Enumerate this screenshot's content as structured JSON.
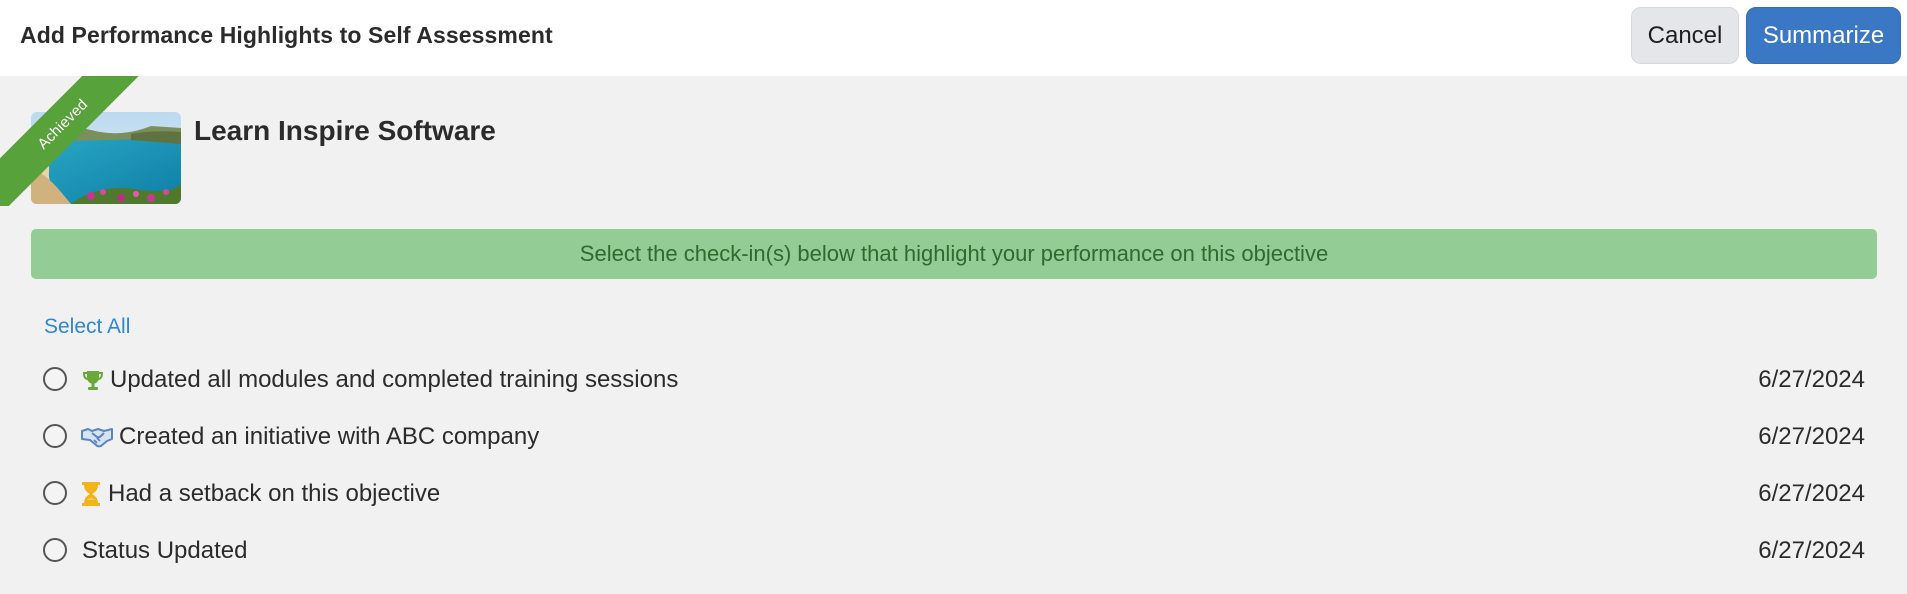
{
  "header": {
    "title": "Add Performance Highlights to Self Assessment",
    "cancel_label": "Cancel",
    "summarize_label": "Summarize"
  },
  "objective": {
    "title": "Learn Inspire Software",
    "status_ribbon": "Achieved",
    "thumbnail_icon": "beach-landscape-image"
  },
  "banner": {
    "text": "Select the check-in(s) below that highlight your performance on this objective"
  },
  "select_all_label": "Select All",
  "checkins": [
    {
      "icon": "trophy-icon",
      "text": "Updated all modules and completed training sessions",
      "date": "6/27/2024"
    },
    {
      "icon": "handshake-icon",
      "text": "Created an initiative with ABC company",
      "date": "6/27/2024"
    },
    {
      "icon": "hourglass-icon",
      "text": "Had a setback on this objective",
      "date": "6/27/2024"
    },
    {
      "icon": "",
      "text": "Status Updated",
      "date": "6/27/2024"
    }
  ],
  "colors": {
    "primary_button": "#3a77c4",
    "banner_bg": "#93cc95",
    "banner_text": "#2f6a2f",
    "ribbon": "#57a23a",
    "link": "#2d86d6",
    "trophy": "#6aa83a",
    "handshake": "#5a86c0",
    "hourglass": "#f2b31b"
  }
}
